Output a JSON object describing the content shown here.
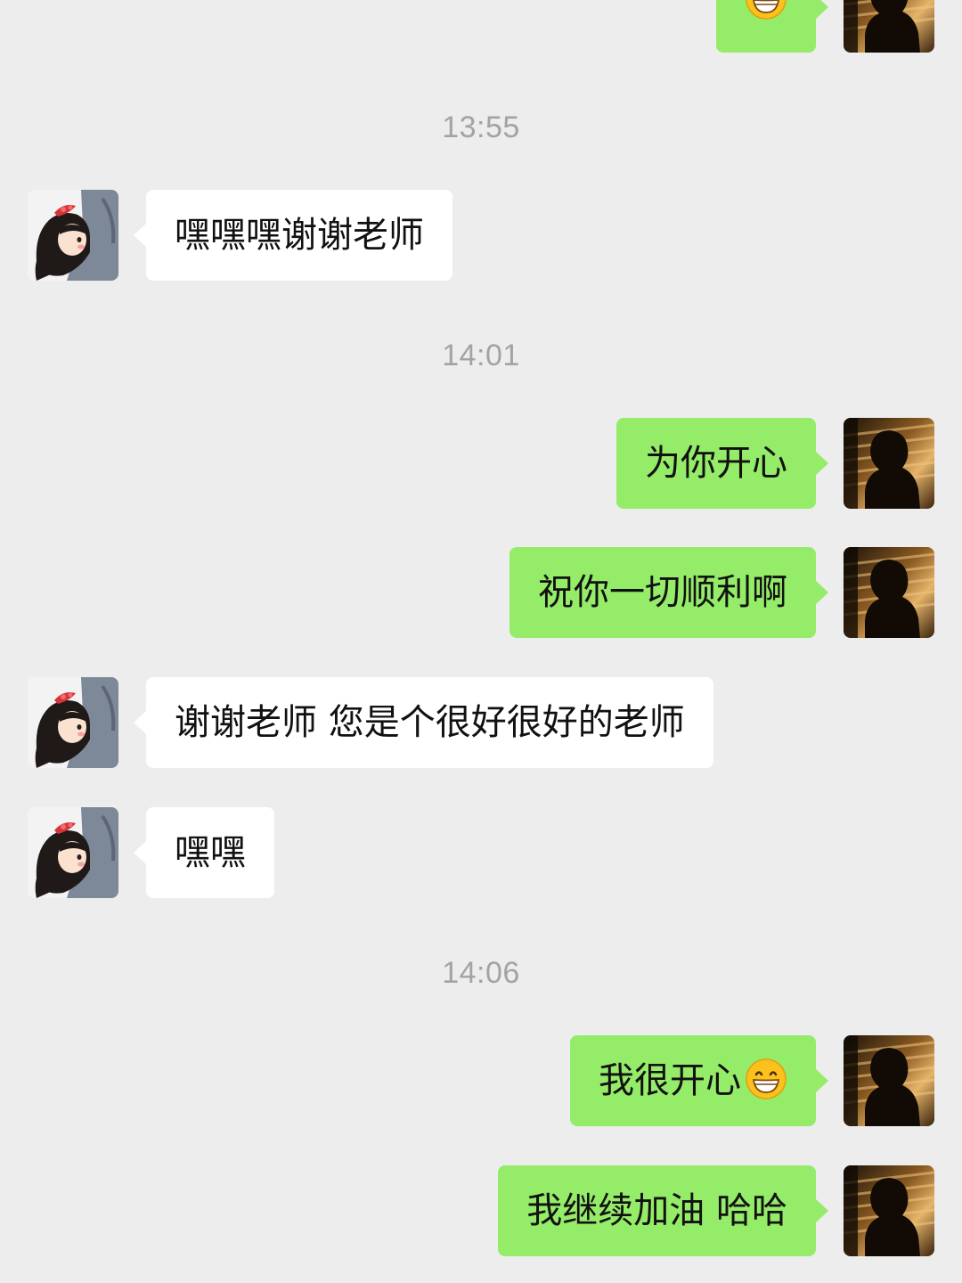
{
  "timestamps": [
    "13:55",
    "14:01",
    "14:06"
  ],
  "messages": [
    {
      "side": "outgoing",
      "text": "",
      "emoji": "grinning-face-icon"
    },
    {
      "side": "incoming",
      "text": "嘿嘿嘿谢谢老师"
    },
    {
      "side": "outgoing",
      "text": "为你开心"
    },
    {
      "side": "outgoing",
      "text": "祝你一切顺利啊"
    },
    {
      "side": "incoming",
      "text": "谢谢老师 您是个很好很好的老师"
    },
    {
      "side": "incoming",
      "text": "嘿嘿"
    },
    {
      "side": "outgoing",
      "text": "我很开心",
      "emoji": "grinning-face-icon"
    },
    {
      "side": "outgoing",
      "text": "我继续加油 哈哈"
    }
  ],
  "colors": {
    "background": "#ededed",
    "outgoing_bubble": "#95ec69",
    "incoming_bubble": "#ffffff",
    "timestamp": "#a3a3a3"
  },
  "avatars": {
    "incoming": "girl-avatar-icon",
    "outgoing": "silhouette-avatar-icon"
  }
}
